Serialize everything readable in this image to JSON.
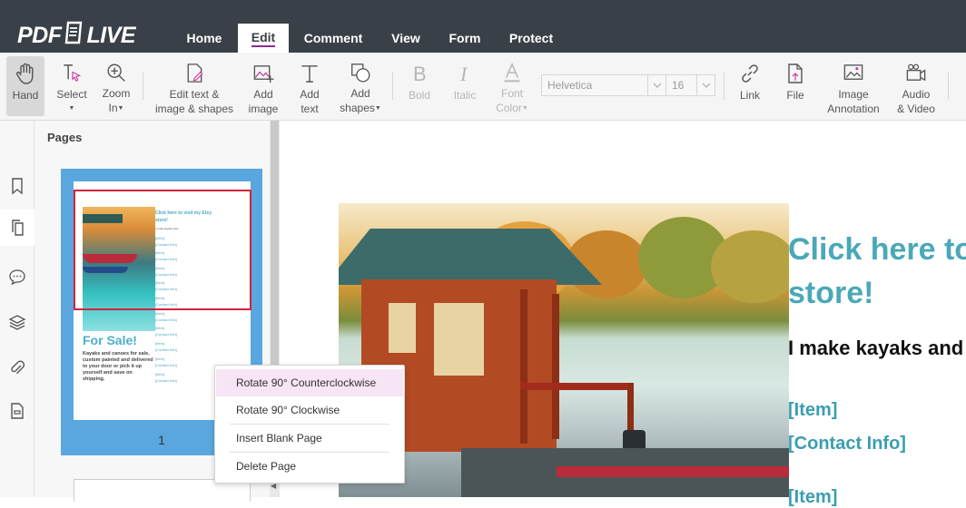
{
  "app": {
    "logo_left": "PDF",
    "logo_right": "LIVE"
  },
  "nav": {
    "tabs": [
      {
        "label": "Home"
      },
      {
        "label": "Edit"
      },
      {
        "label": "Comment"
      },
      {
        "label": "View"
      },
      {
        "label": "Form"
      },
      {
        "label": "Protect"
      }
    ],
    "active": "Edit"
  },
  "toolbar": {
    "hand": {
      "line1": "Hand",
      "icon": "hand-icon"
    },
    "select": {
      "line1": "Select",
      "icon": "select-cursor-icon"
    },
    "zoom": {
      "line1": "Zoom",
      "line2": "In",
      "icon": "zoom-in-icon"
    },
    "edit_text": {
      "line1": "Edit text &",
      "line2": "image & shapes",
      "icon": "edit-document-icon"
    },
    "add_image": {
      "line1": "Add",
      "line2": "image",
      "icon": "add-image-icon"
    },
    "add_text": {
      "line1": "Add",
      "line2": "text",
      "icon": "text-icon"
    },
    "add_shapes": {
      "line1": "Add",
      "line2": "shapes",
      "icon": "shapes-icon"
    },
    "bold": {
      "line1": "Bold",
      "icon": "bold-icon"
    },
    "italic": {
      "line1": "Italic",
      "icon": "italic-icon"
    },
    "font_color": {
      "line1": "Font",
      "line2": "Color",
      "icon": "font-color-icon"
    },
    "font_family": "Helvetica",
    "font_size": "16",
    "link": {
      "line1": "Link",
      "icon": "link-icon"
    },
    "file": {
      "line1": "File",
      "icon": "file-attach-icon"
    },
    "image_annotation": {
      "line1": "Image",
      "line2": "Annotation",
      "icon": "image-annotation-icon"
    },
    "audio_video": {
      "line1": "Audio",
      "line2": "& Video",
      "icon": "camera-icon"
    }
  },
  "pages_panel": {
    "title": "Pages",
    "page_number": "1",
    "thumb_link": "Click here to visit my Etsy store!",
    "thumb_sub": "I make kayaks and...",
    "thumb_items": [
      "[Item]",
      "[Contact Info]",
      "[Item]",
      "[Contact Info]",
      "[Item]",
      "[Contact Info]",
      "[Item]",
      "[Contact Info]",
      "[Item]",
      "[Contact Info]",
      "[Item]",
      "[Contact Info]",
      "[Item]",
      "[Contact Info]",
      "[Item]",
      "[Contact Info]",
      "[Item]",
      "[Contact Info]",
      "[Item]",
      "[Contact Info]"
    ],
    "thumb_forsale": "For Sale!",
    "thumb_body": "Kayaks and canoes for sale, custom painted and delivered to your door or pick it up yourself and save on shipping."
  },
  "context_menu": {
    "items": [
      {
        "label": "Rotate 90° Counterclockwise"
      },
      {
        "label": "Rotate 90° Clockwise"
      },
      {
        "label": "Insert Blank Page"
      },
      {
        "label": "Delete Page"
      }
    ]
  },
  "document": {
    "title_line1": "Click here to",
    "title_line2": "store!",
    "subtitle": "I make kayaks and",
    "item": "[Item]",
    "contact": "[Contact Info]"
  },
  "colors": {
    "topbar": "#3a4047",
    "accent": "#8a2a8e",
    "selection": "#5aa7df",
    "page_selection": "#d0243c",
    "doc_title": "#4aa8b8"
  }
}
